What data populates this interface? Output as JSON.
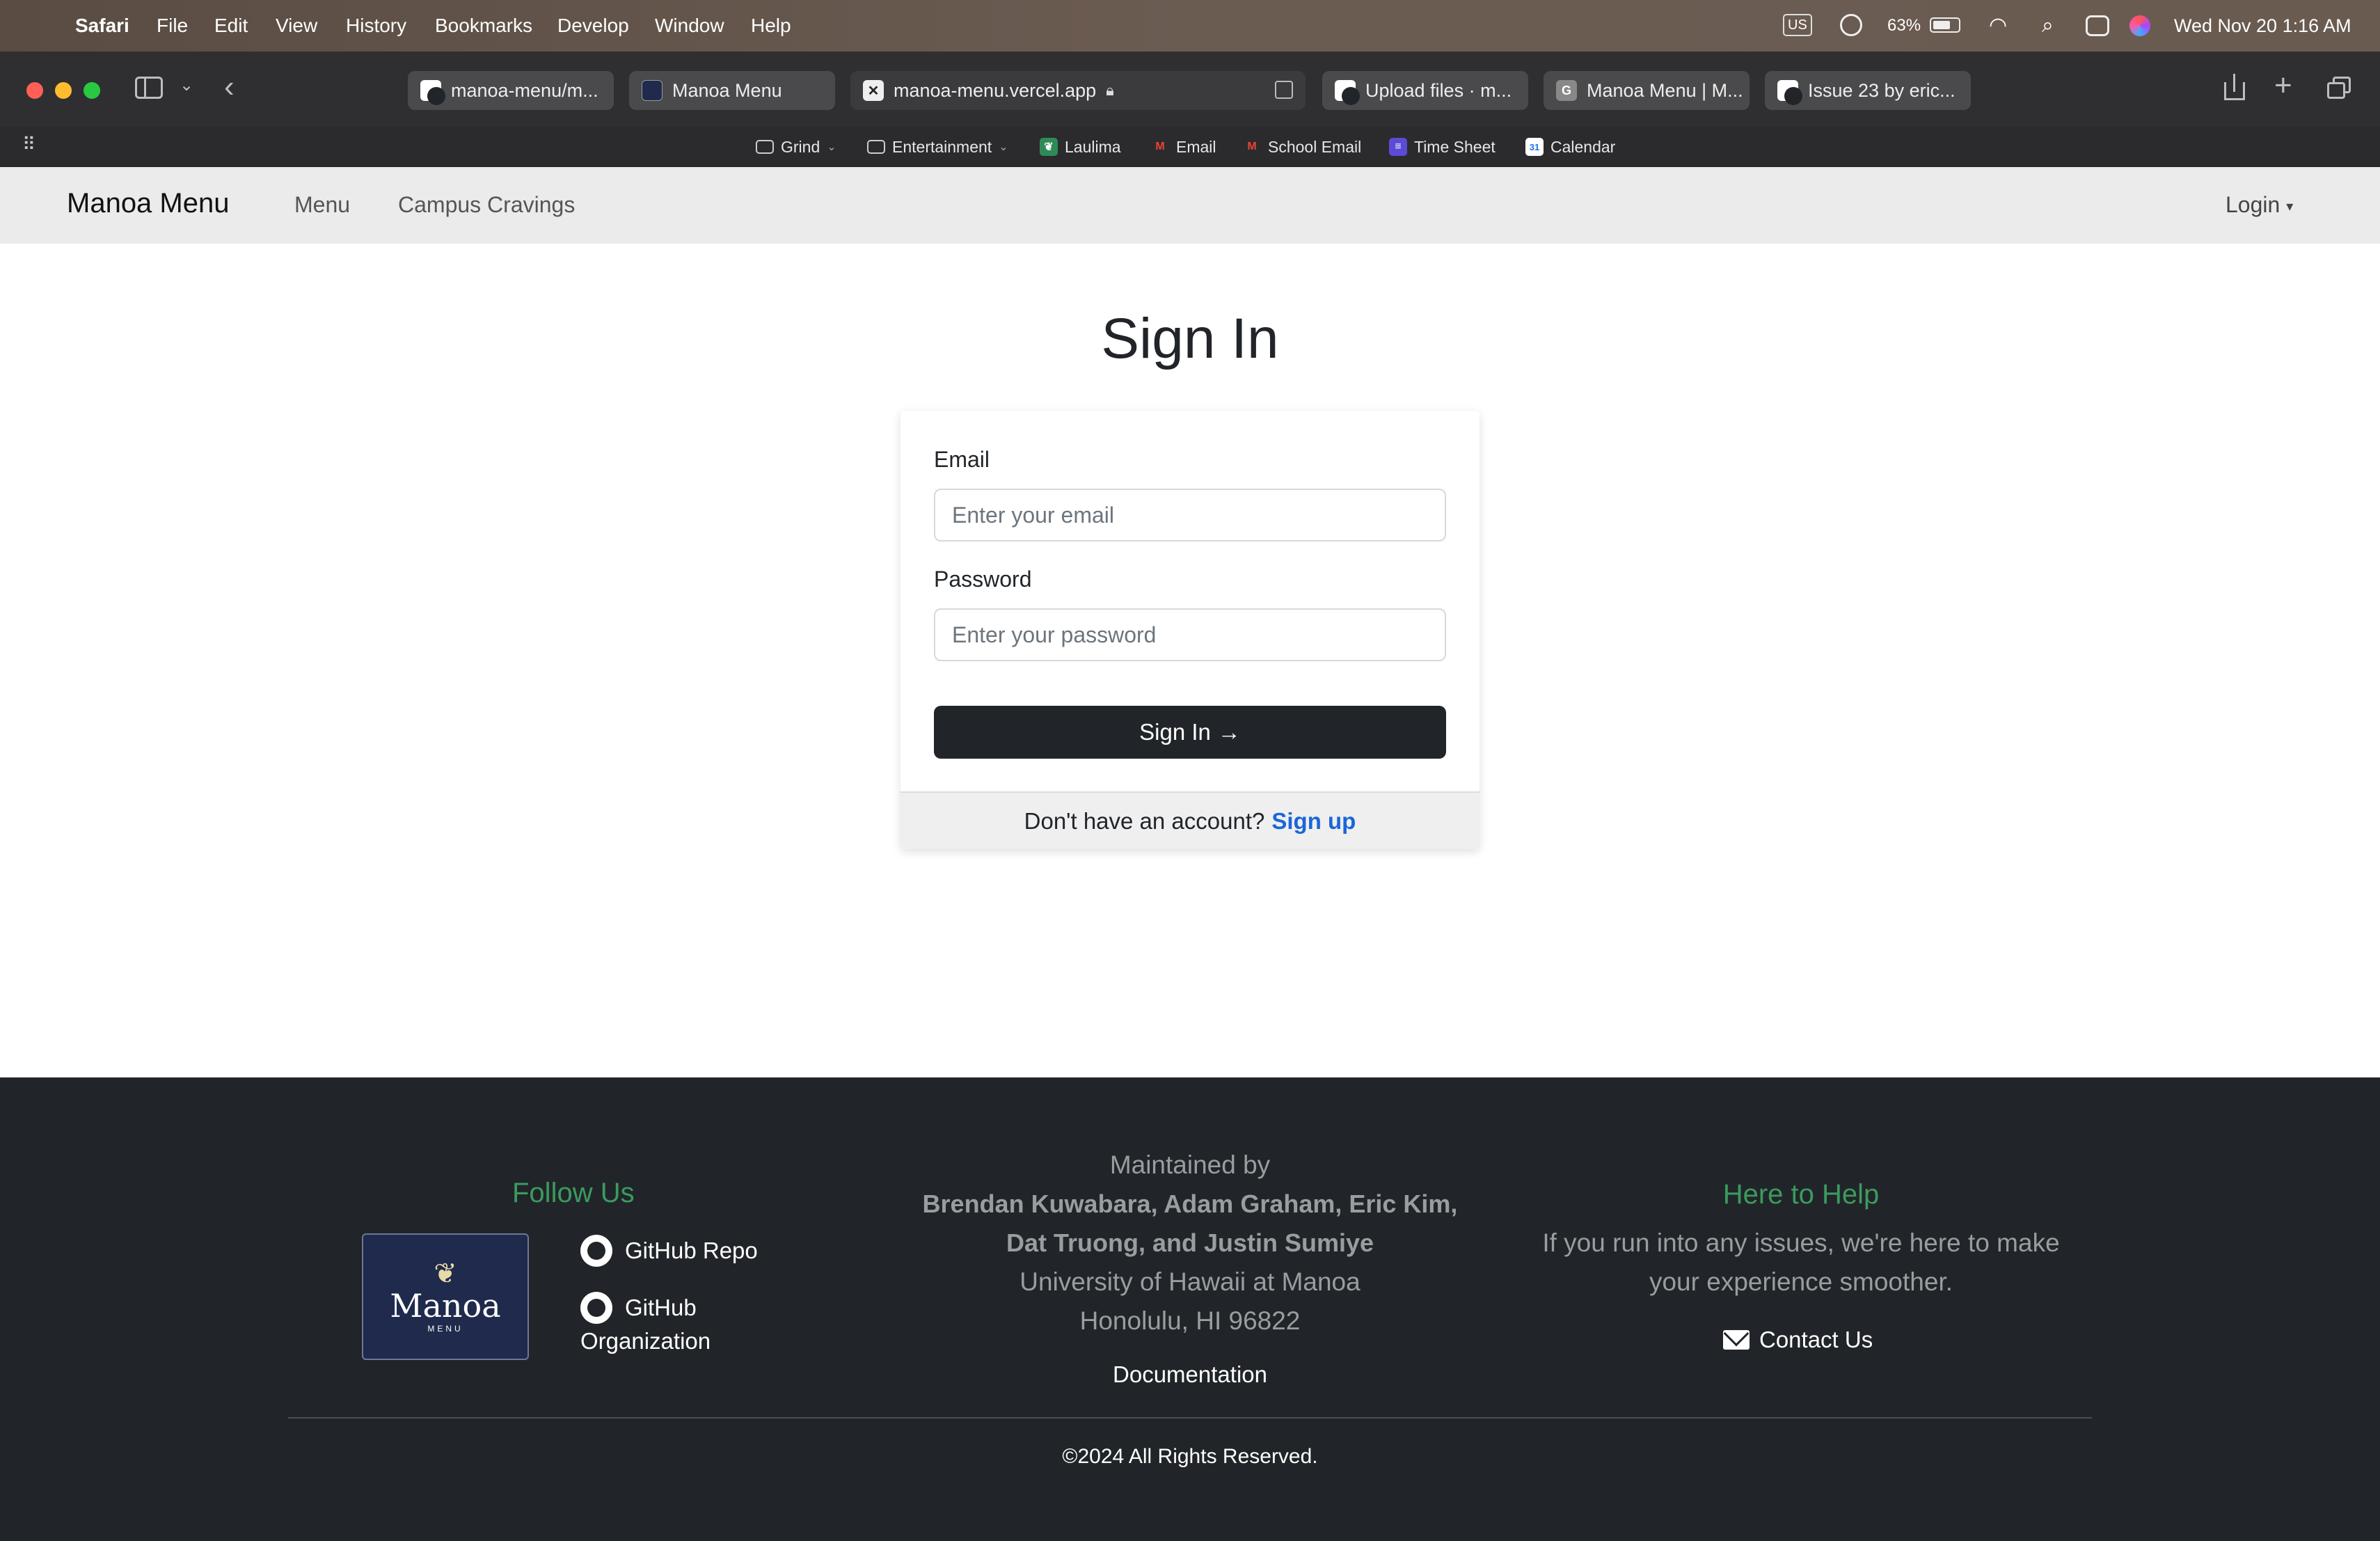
{
  "menubar": {
    "app": "Safari",
    "items": [
      "File",
      "Edit",
      "View",
      "History",
      "Bookmarks",
      "Develop",
      "Window",
      "Help"
    ],
    "input_source": "US",
    "battery": "63%",
    "clock": "Wed Nov 20  1:16 AM"
  },
  "tabs": [
    {
      "title": "manoa-menu/m...",
      "icon": "github-icon"
    },
    {
      "title": "Manoa Menu",
      "icon": "manoa-favicon"
    },
    {
      "title": "manoa-menu.vercel.app",
      "icon": "vercel-icon"
    },
    {
      "title": "Upload files · m...",
      "icon": "github-icon"
    },
    {
      "title": "Manoa Menu | M...",
      "icon": "google-icon"
    },
    {
      "title": "Issue 23 by eric...",
      "icon": "github-icon"
    }
  ],
  "bookmarks": [
    {
      "label": "Grind",
      "icon": "folder-icon"
    },
    {
      "label": "Entertainment",
      "icon": "folder-icon"
    },
    {
      "label": "Laulima",
      "icon": "laulima-icon"
    },
    {
      "label": "Email",
      "icon": "gmail-icon"
    },
    {
      "label": "School Email",
      "icon": "gmail-icon"
    },
    {
      "label": "Time Sheet",
      "icon": "timesheet-icon"
    },
    {
      "label": "Calendar",
      "icon": "calendar-icon"
    }
  ],
  "navbar": {
    "brand": "Manoa Menu",
    "links": [
      "Menu",
      "Campus Cravings"
    ],
    "login": "Login"
  },
  "signin": {
    "title": "Sign In",
    "email_label": "Email",
    "email_placeholder": "Enter your email",
    "password_label": "Password",
    "password_placeholder": "Enter your password",
    "button": "Sign In",
    "button_arrow": "→",
    "no_account": "Don't have an account?",
    "signup": "Sign up"
  },
  "footer": {
    "follow_title": "Follow Us",
    "logo_text": "Manoa",
    "logo_sub": "MENU",
    "github_repo": "GitHub Repo",
    "github_org_1": "GitHub",
    "github_org_2": "Organization",
    "maintained_by": "Maintained by",
    "names_1": "Brendan Kuwabara, Adam Graham, Eric Kim,",
    "names_2": "Dat Truong, and Justin Sumiye",
    "university": "University of Hawaii at Manoa",
    "address": "Honolulu, HI 96822",
    "documentation": "Documentation",
    "help_title": "Here to Help",
    "help_text_1": "If you run into any issues, we're here to make",
    "help_text_2": "your experience smoother.",
    "contact": "Contact Us",
    "copyright": "©2024 All Rights Reserved."
  },
  "colors": {
    "navbar_bg": "#ebebeb",
    "footer_bg": "#212529",
    "accent_green": "#3c9a5f",
    "link_blue": "#1a66d8",
    "button_dark": "#212529"
  }
}
